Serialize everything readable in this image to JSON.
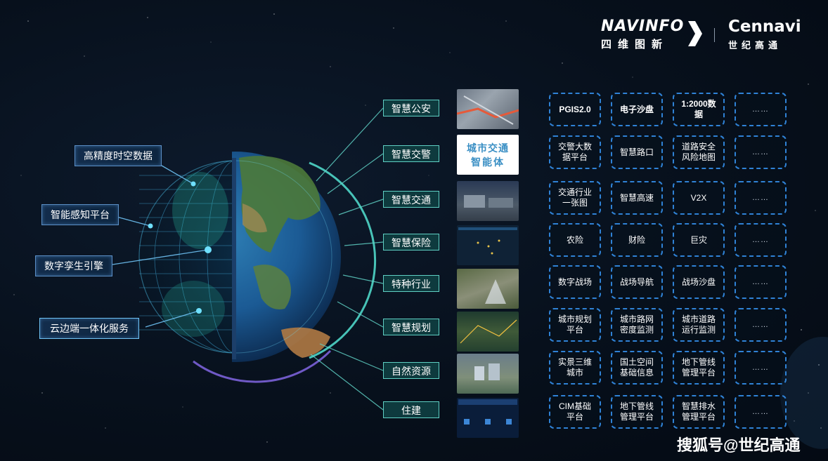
{
  "header": {
    "navinfo_brand": "NAVINFO",
    "navinfo_sub": "四维图新",
    "cennavi_brand": "Cennavi",
    "cennavi_sub": "世纪高通"
  },
  "features": [
    "高精度时空数据",
    "智能感知平台",
    "数字孪生引擎",
    "云边端一体化服务"
  ],
  "industries": [
    "智慧公安",
    "智慧交警",
    "智慧交通",
    "智慧保险",
    "特种行业",
    "智慧规划",
    "自然资源",
    "住建"
  ],
  "thumb_text": {
    "traffic_line1": "城市交通",
    "traffic_line2": "智能体"
  },
  "grid": [
    [
      "PGIS2.0",
      "电子沙盘",
      "1:2000数\n据",
      "……"
    ],
    [
      "交警大数\n据平台",
      "智慧路口",
      "道路安全\n风险地图",
      "……"
    ],
    [
      "交通行业\n一张图",
      "智慧高速",
      "V2X",
      "……"
    ],
    [
      "农险",
      "财险",
      "巨灾",
      "……"
    ],
    [
      "数字战场",
      "战场导航",
      "战场沙盘",
      "……"
    ],
    [
      "城市规划\n平台",
      "城市路网\n密度监测",
      "城市道路\n运行监测",
      "……"
    ],
    [
      "实景三维\n城市",
      "国土空间\n基础信息",
      "地下管线\n管理平台",
      "……"
    ],
    [
      "CIM基础\n平台",
      "地下管线\n管理平台",
      "智慧排水\n管理平台",
      "……"
    ]
  ],
  "watermark": "搜狐号@世纪高通",
  "colors": {
    "background": "#07101c",
    "industry_border": "#5fd0c4",
    "box_border": "#2f82d6",
    "feature_border": "#5b8fc6"
  }
}
